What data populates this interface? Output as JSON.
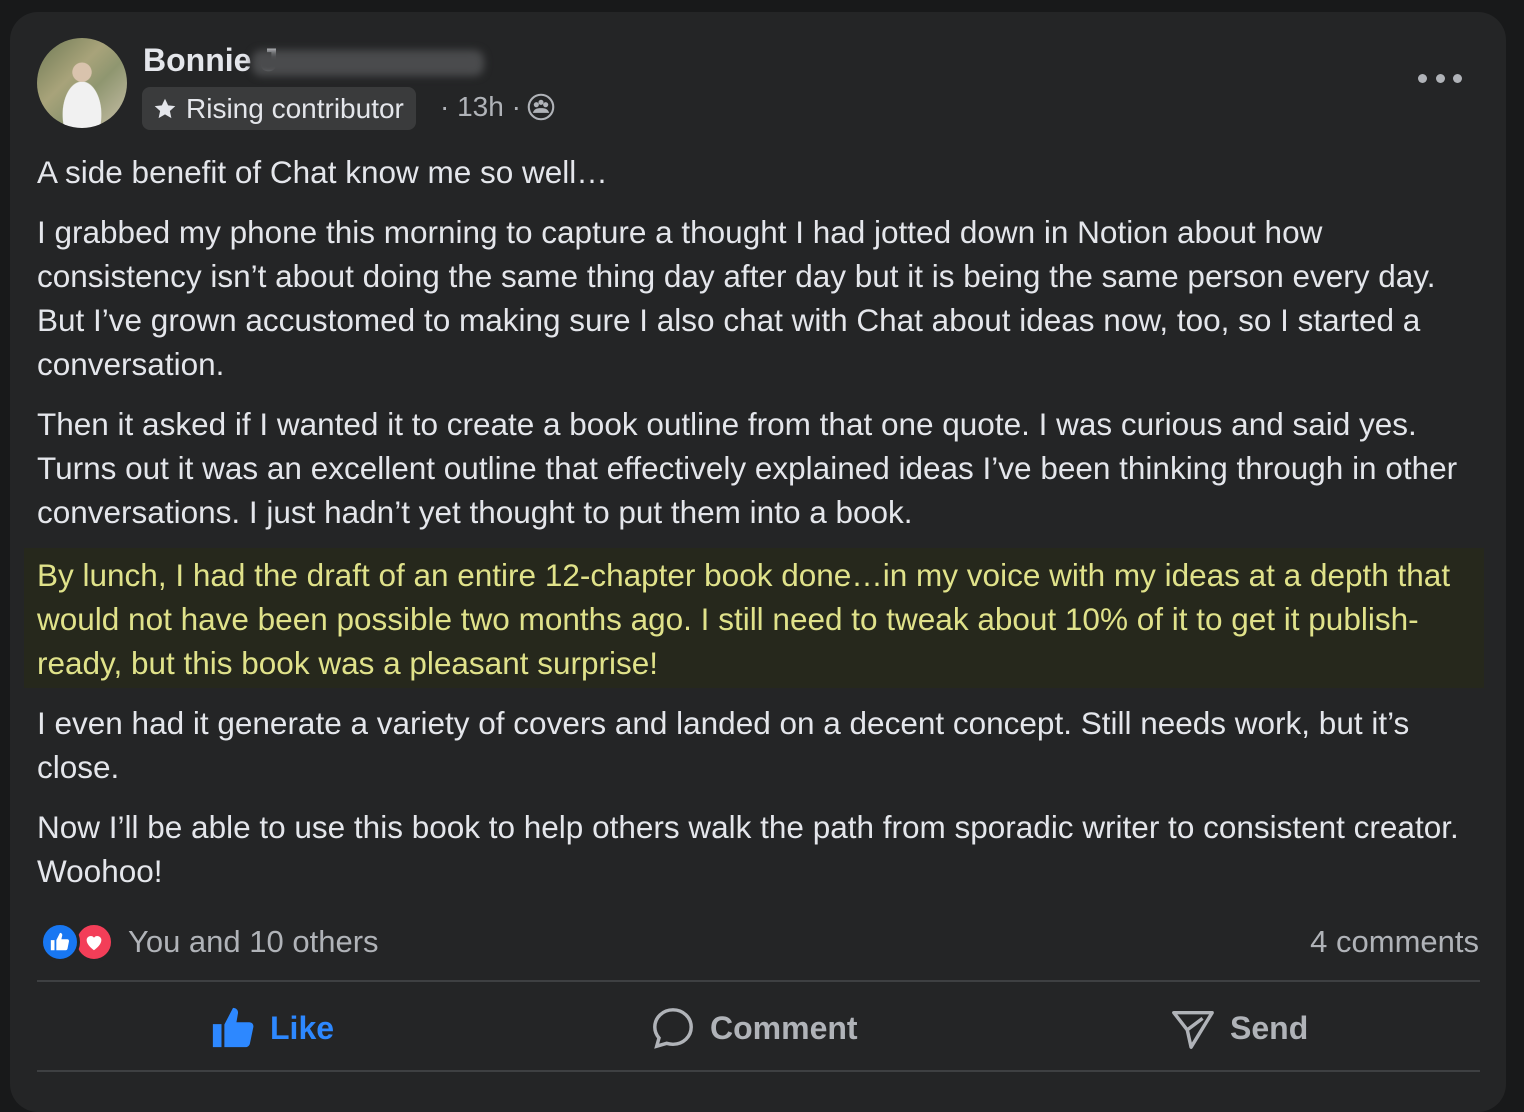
{
  "author": {
    "name": "Bonnie J",
    "badge": "Rising contributor",
    "time": "· 13h ·",
    "badge_icon": "star-icon",
    "audience_icon": "group-icon"
  },
  "post": {
    "paragraphs": [
      "A side benefit of Chat know me so well…",
      "I grabbed my phone this morning to capture a thought I had jotted down in Notion about how consistency isn’t about doing the same thing day after day but it is being the same person every day. But I’ve grown accustomed to making sure I also chat with Chat about ideas now, too, so I started a conversation.",
      "Then it asked if I wanted it to create a book outline from that one quote. I was curious and said yes. Turns out it was an excellent outline that effectively explained ideas I’ve been thinking through in other conversations. I just hadn’t yet thought to put them into a book."
    ],
    "highlighted": "By lunch, I had the draft of an entire 12-chapter book done…in my voice with my ideas at a depth that would not have been possible two months ago. I still need to tweak about 10% of it to get it publish-ready, but this book was a pleasant surprise!",
    "paragraphs_after": [
      "I even had it generate a variety of covers and landed on a decent concept. Still needs work, but it’s close.",
      "Now I’ll be able to use this book to help others walk the path from sporadic writer to consistent creator. Woohoo!"
    ]
  },
  "engagement": {
    "reactions_text": "You and 10 others",
    "comments_text": "4 comments"
  },
  "actions": {
    "like": "Like",
    "comment": "Comment",
    "send": "Send"
  },
  "colors": {
    "background": "#242526",
    "highlight_bg": "#26281c",
    "highlight_text": "#e0e28a",
    "like_blue": "#2d88ff",
    "love_red": "#f33e58"
  }
}
